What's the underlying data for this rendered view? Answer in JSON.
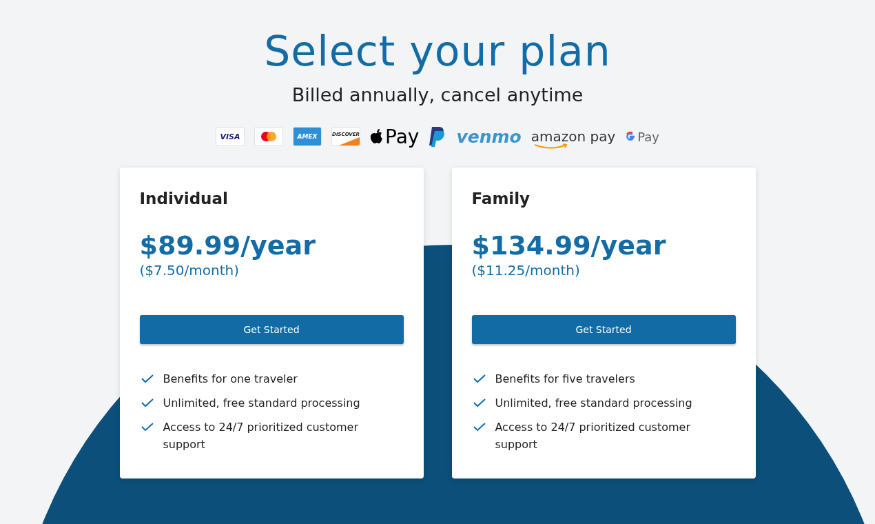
{
  "header": {
    "title": "Select your plan",
    "subtitle": "Billed annually, cancel anytime"
  },
  "payment_methods": [
    {
      "kind": "card",
      "label": "VISA"
    },
    {
      "kind": "mastercard"
    },
    {
      "kind": "amex",
      "label": "AMEX"
    },
    {
      "kind": "discover",
      "label": "DISCOVER"
    },
    {
      "kind": "apple",
      "label": "Pay"
    },
    {
      "kind": "paypal"
    },
    {
      "kind": "venmo",
      "label": "venmo"
    },
    {
      "kind": "amazon",
      "label": "amazon pay"
    },
    {
      "kind": "google",
      "label": "Pay"
    }
  ],
  "plans": [
    {
      "name": "Individual",
      "price": "$89.99/year",
      "monthly": "($7.50/month)",
      "button": "Get Started",
      "features": [
        "Benefits for one traveler",
        "Unlimited, free standard processing",
        "Access to 24/7 prioritized customer support"
      ]
    },
    {
      "name": "Family",
      "price": "$134.99/year",
      "monthly": "($11.25/month)",
      "button": "Get Started",
      "features": [
        "Benefits for five travelers",
        "Unlimited, free standard processing",
        "Access to 24/7 prioritized customer support"
      ]
    }
  ]
}
